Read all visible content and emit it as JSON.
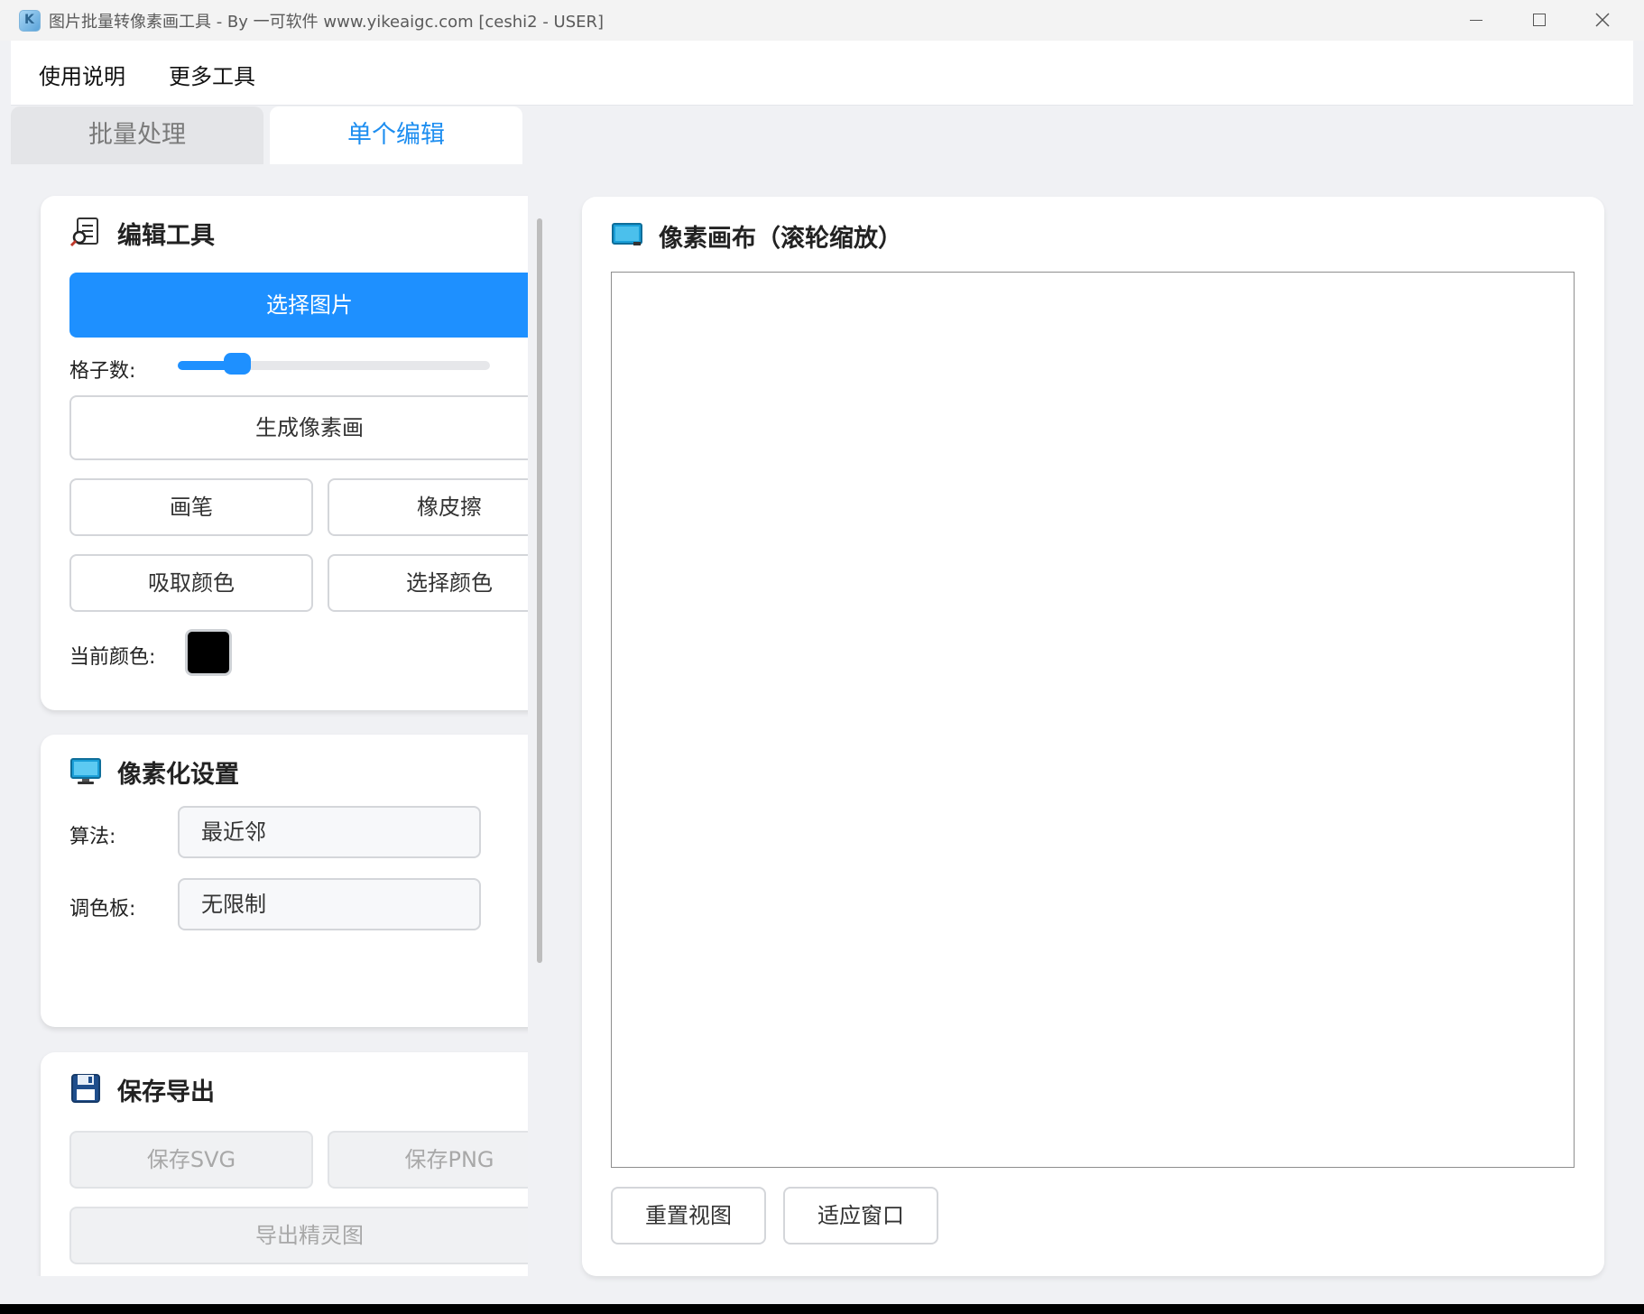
{
  "window": {
    "title": "图片批量转像素画工具 - By 一可软件 www.yikeaigc.com [ceshi2 - USER]",
    "app_icon_letter": "K"
  },
  "menu": {
    "items": [
      "使用说明",
      "更多工具"
    ]
  },
  "tabs": [
    {
      "label": "批量处理",
      "active": false
    },
    {
      "label": "单个编辑",
      "active": true
    }
  ],
  "edit_tools": {
    "title": "编辑工具",
    "select_image": "选择图片",
    "grid_label": "格子数:",
    "grid_slider_fraction": 0.19,
    "generate": "生成像素画",
    "brush": "画笔",
    "eraser": "橡皮擦",
    "pick_color": "吸取颜色",
    "choose_color": "选择颜色",
    "current_color_label": "当前颜色:",
    "current_color": "#000000"
  },
  "pixel_settings": {
    "title": "像素化设置",
    "algorithm_label": "算法:",
    "algorithm_value": "最近邻",
    "palette_label": "调色板:",
    "palette_value": "无限制"
  },
  "export": {
    "title": "保存导出",
    "save_svg": "保存SVG",
    "save_png": "保存PNG",
    "export_sprite": "导出精灵图"
  },
  "canvas": {
    "title": "像素画布（滚轮缩放）",
    "reset_view": "重置视图",
    "fit_window": "适应窗口"
  },
  "colors": {
    "accent": "#1e90ff",
    "tab_active": "#1e8ef0"
  }
}
